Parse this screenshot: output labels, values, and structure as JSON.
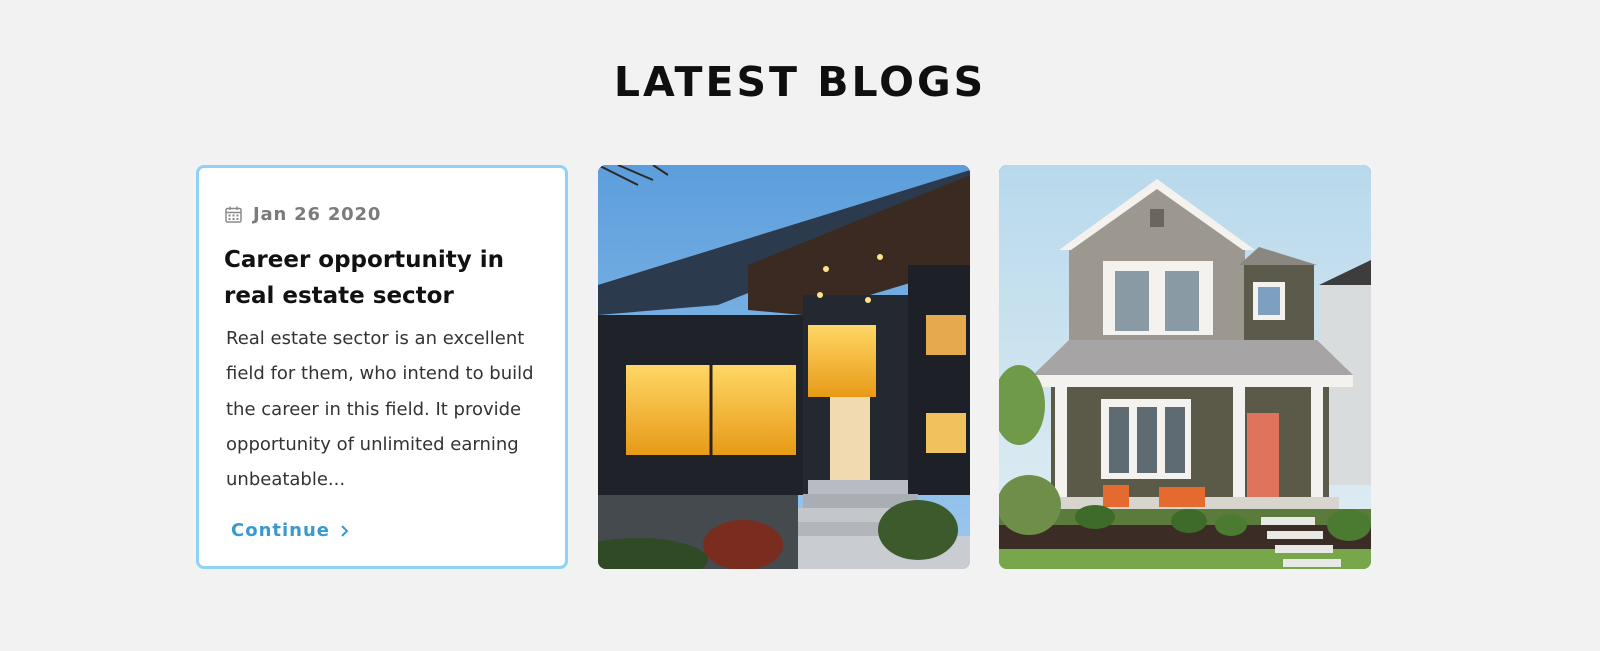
{
  "section": {
    "title": "LATEST BLOGS"
  },
  "post": {
    "date": "Jan 26 2020",
    "title": "Career opportunity in real estate sector",
    "excerpt": "Real estate sector is an excellent field for them, who intend to build the career in this field. It provide opportunity of unlimited earning unbeatable...",
    "cta": "Continue"
  },
  "icons": {
    "date": "calendar-icon",
    "cta": "chevron-right-icon"
  },
  "colors": {
    "background": "#f2f2f2",
    "card_border": "#8fd3f4",
    "accent": "#3a9ad0",
    "title": "#111111",
    "muted": "#7b7b7b"
  }
}
